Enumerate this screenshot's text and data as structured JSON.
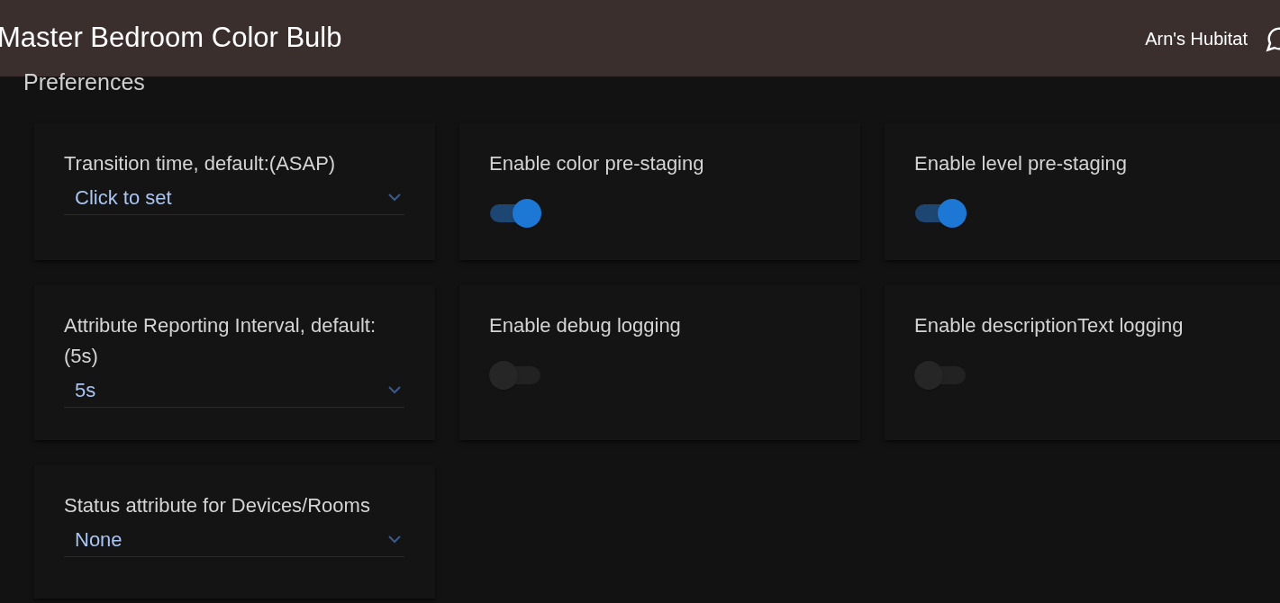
{
  "header": {
    "title": "Master Bedroom Color Bulb",
    "hub_name": "Arn's Hubitat"
  },
  "section": {
    "title": "Preferences"
  },
  "preferences": [
    {
      "kind": "select",
      "label": "Transition time, default:(ASAP)",
      "value": "Click to set"
    },
    {
      "kind": "toggle",
      "label": "Enable color pre-staging",
      "on": true
    },
    {
      "kind": "toggle",
      "label": "Enable level pre-staging",
      "on": true
    },
    {
      "kind": "select",
      "label": "Attribute Reporting Interval, default:(5s)",
      "value": "5s"
    },
    {
      "kind": "toggle",
      "label": "Enable debug logging",
      "on": false
    },
    {
      "kind": "toggle",
      "label": "Enable descriptionText logging",
      "on": false
    },
    {
      "kind": "select",
      "label": "Status attribute for Devices/Rooms",
      "value": "None"
    }
  ]
}
